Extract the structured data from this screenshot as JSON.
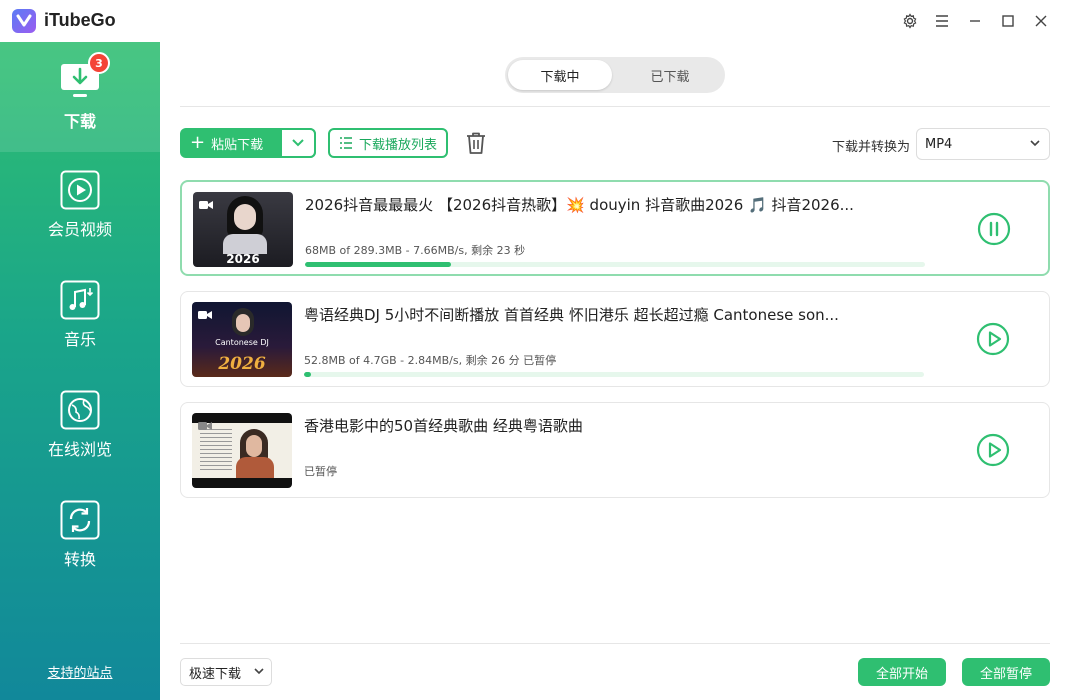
{
  "app": {
    "title": "iTubeGo"
  },
  "sidebar": {
    "badge_count": "3",
    "items": [
      {
        "label": "下载",
        "icon": "download-icon"
      },
      {
        "label": "会员视频",
        "icon": "play-circle-icon"
      },
      {
        "label": "音乐",
        "icon": "music-icon"
      },
      {
        "label": "在线浏览",
        "icon": "browser-globe-icon"
      },
      {
        "label": "转换",
        "icon": "convert-icon"
      }
    ],
    "supported_sites": "支持的站点"
  },
  "tabs": {
    "downloading": "下载中",
    "downloaded": "已下载"
  },
  "toolbar": {
    "paste_label": "粘贴下载",
    "playlist_label": "下载播放列表",
    "convert_label": "下载并转换为",
    "format": "MP4"
  },
  "downloads": [
    {
      "title": "2026抖音最最最火 【2026抖音热歌】💥 douyin 抖音歌曲2026 🎵 抖音2026...",
      "status": "68MB of 289.3MB -    7.66MB/s, 剩余 23 秒",
      "progress": 0.235,
      "control": "pause",
      "thumb_text": "2026"
    },
    {
      "title": "粤语经典DJ 5小时不间断播放 首首经典 怀旧港乐 超长超过瘾 Cantonese son...",
      "status": "52.8MB of 4.7GB -    2.84MB/s, 剩余 26 分 已暂停",
      "progress": 0.011,
      "control": "play",
      "thumb_text": "Cantonese DJ"
    },
    {
      "title": "香港电影中的50首经典歌曲 经典粤语歌曲",
      "status": "已暂停",
      "progress": null,
      "control": "play",
      "thumb_text": ""
    }
  ],
  "footer": {
    "speed": "极速下载",
    "start_all": "全部开始",
    "pause_all": "全部暂停"
  },
  "colors": {
    "accent": "#2fbf71",
    "badge": "#f44336"
  }
}
